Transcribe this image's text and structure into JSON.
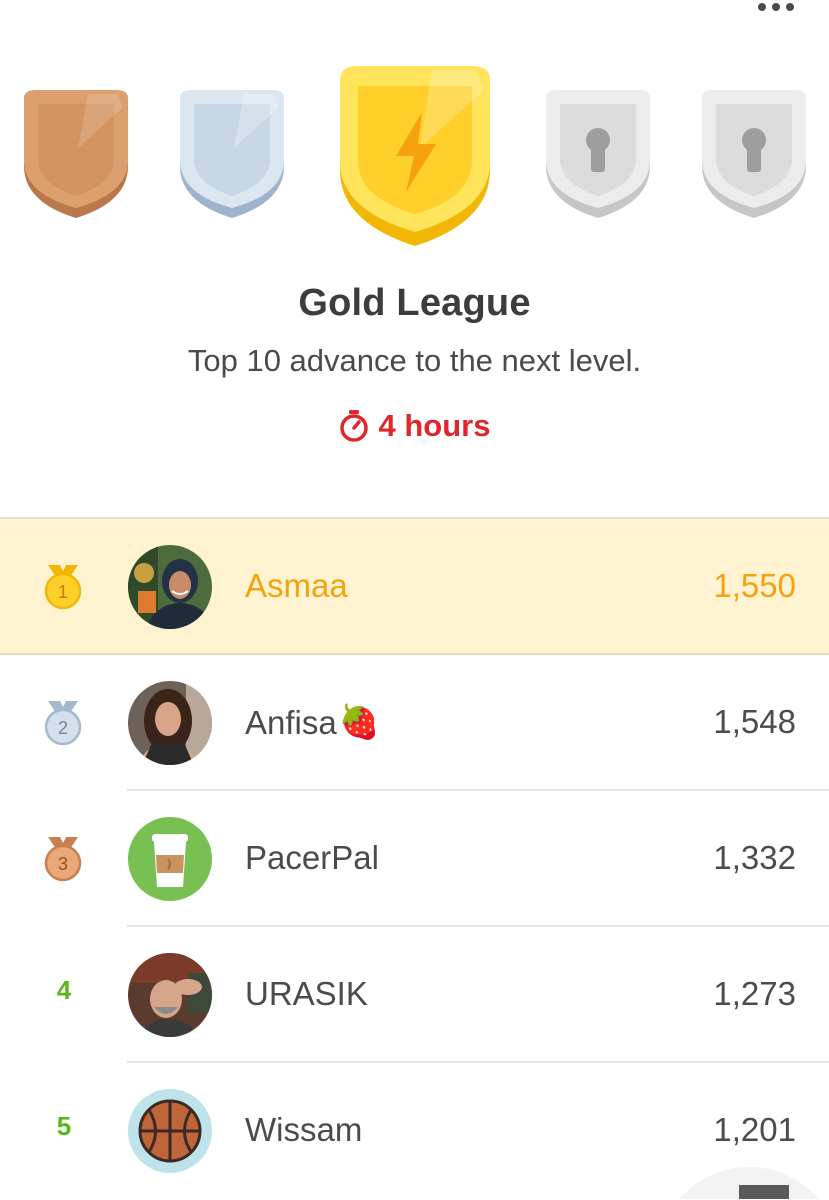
{
  "colors": {
    "highlight_row": "#fff3d1",
    "highlight_text": "#f5a20e",
    "timer_red": "#e0262b",
    "rank_green": "#58b81a",
    "gold": "#ffd02a",
    "silver": "#c8d7e6",
    "bronze": "#dca06e",
    "locked": "#dcdcdc"
  },
  "header": {
    "more_icon": "more-horizontal-icon"
  },
  "badges": [
    {
      "name": "bronze",
      "icon": "shield-icon",
      "state": "unlocked"
    },
    {
      "name": "silver",
      "icon": "shield-icon",
      "state": "unlocked"
    },
    {
      "name": "gold",
      "icon": "lightning-bolt-icon",
      "state": "current"
    },
    {
      "name": "locked-1",
      "icon": "keyhole-lock-icon",
      "state": "locked"
    },
    {
      "name": "locked-2",
      "icon": "keyhole-lock-icon",
      "state": "locked"
    }
  ],
  "league": {
    "title": "Gold League",
    "subtitle": "Top 10 advance to the next level.",
    "timer_icon": "stopwatch-icon",
    "time_left": "4 hours"
  },
  "leaderboard": [
    {
      "rank": "1",
      "rank_style": "gold-medal",
      "name": "Asmaa",
      "flair": "",
      "xp": "1,550",
      "avatar": "photo-avatar",
      "highlight": true
    },
    {
      "rank": "2",
      "rank_style": "silver-medal",
      "name": "Anfisa",
      "flair": "🍓",
      "xp": "1,548",
      "avatar": "photo-avatar",
      "highlight": false
    },
    {
      "rank": "3",
      "rank_style": "bronze-medal",
      "name": "PacerPal",
      "flair": "",
      "xp": "1,332",
      "avatar": "coffee-cup-avatar",
      "highlight": false
    },
    {
      "rank": "4",
      "rank_style": "number",
      "name": "URASIK",
      "flair": "",
      "xp": "1,273",
      "avatar": "photo-avatar",
      "highlight": false
    },
    {
      "rank": "5",
      "rank_style": "number",
      "name": "Wissam",
      "flair": "",
      "xp": "1,201",
      "avatar": "basketball-avatar",
      "highlight": false
    }
  ]
}
